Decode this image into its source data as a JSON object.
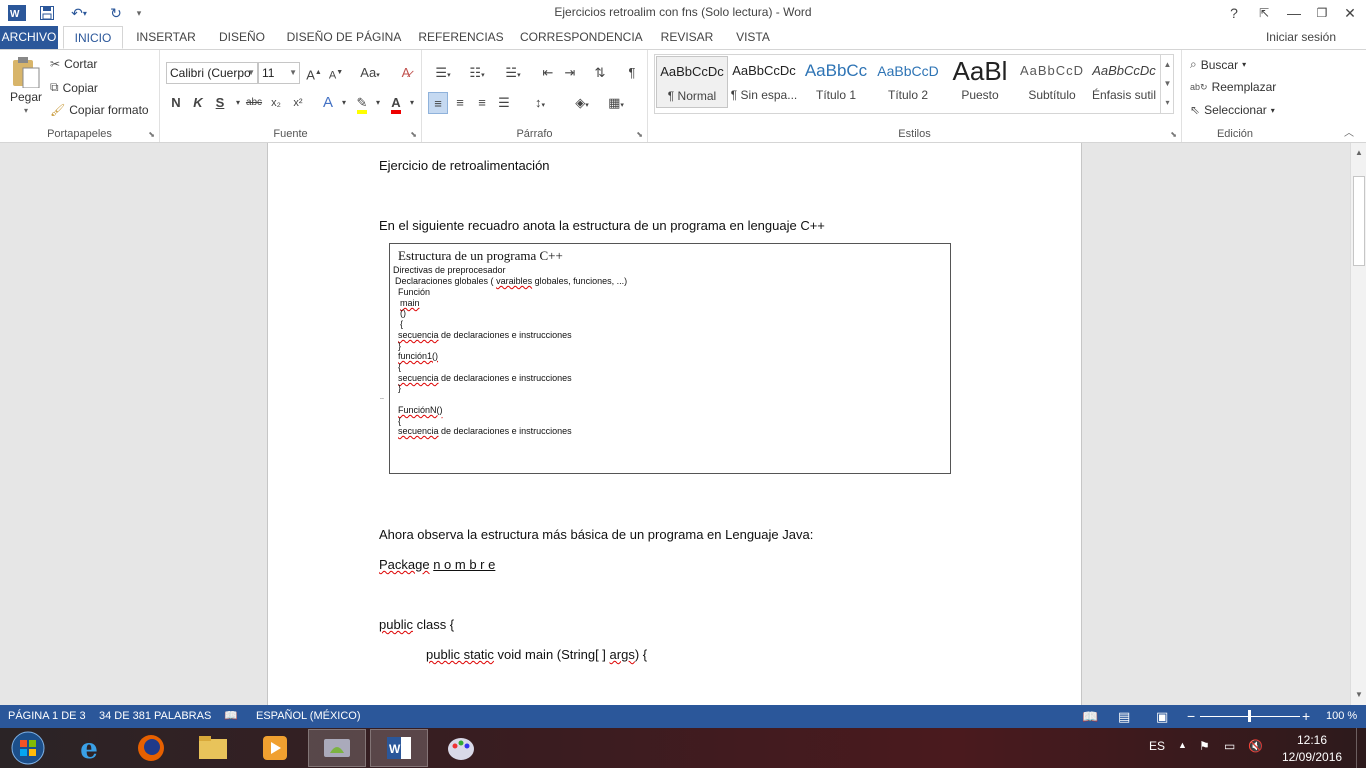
{
  "window": {
    "title": "Ejercicios retroalim con fns (Solo lectura) - Word",
    "help": "?",
    "minimize": "—",
    "restore": "❐",
    "close": "✕"
  },
  "tabs": [
    "ARCHIVO",
    "INICIO",
    "INSERTAR",
    "DISEÑO",
    "DISEÑO DE PÁGINA",
    "REFERENCIAS",
    "CORRESPONDENCIA",
    "REVISAR",
    "VISTA"
  ],
  "signin": "Iniciar sesión",
  "ribbon": {
    "clipboard": {
      "label": "Portapapeles",
      "paste": "Pegar",
      "cut": "Cortar",
      "copy": "Copiar",
      "format_painter": "Copiar formato"
    },
    "font": {
      "label": "Fuente",
      "font_name": "Calibri (Cuerpo",
      "font_size": "11",
      "bold": "N",
      "italic": "K",
      "underline": "S",
      "strike": "abc",
      "sub": "x₂",
      "sup": "x²"
    },
    "paragraph": {
      "label": "Párrafo"
    },
    "styles": {
      "label": "Estilos",
      "items": [
        {
          "preview": "AaBbCcDc",
          "name": "¶ Normal"
        },
        {
          "preview": "AaBbCcDc",
          "name": "¶ Sin espa..."
        },
        {
          "preview": "AaBbCc",
          "name": "Título 1"
        },
        {
          "preview": "AaBbCcD",
          "name": "Título 2"
        },
        {
          "preview": "AaBl",
          "name": "Puesto"
        },
        {
          "preview": "AaBbCcD",
          "name": "Subtítulo"
        },
        {
          "preview": "AaBbCcDc",
          "name": "Énfasis sutil"
        }
      ]
    },
    "editing": {
      "label": "Edición",
      "find": "Buscar",
      "replace": "Reemplazar",
      "select": "Seleccionar"
    }
  },
  "document": {
    "heading": "Ejercicio de retroalimentación",
    "instruction": "En el siguiente recuadro anota la estructura de un programa en lenguaje C++",
    "cpp_box": {
      "title": "Estructura de un programa C++",
      "lines": [
        "Directivas de preprocesador",
        "Declaraciones globales ( varaibles globales, funciones, ...)",
        "Función",
        "main",
        "()",
        "{",
        "secuencia de declaraciones e instrucciones",
        "}",
        "función1()",
        "{",
        "secuencia de declaraciones e instrucciones",
        "}",
        "..",
        "FunciónN()",
        "{",
        "secuencia de declaraciones e instrucciones"
      ]
    },
    "java_intro": "Ahora observa la estructura más básica de un programa en Lenguaje Java:",
    "package_line": "Package   n o m b r e",
    "class_line": "public class {",
    "main_line": "public  static  void  main  (String[ ] args)   {"
  },
  "status": {
    "page": "PÁGINA 1 DE 3",
    "words": "34 DE 381 PALABRAS",
    "language": "ESPAÑOL (MÉXICO)",
    "zoom": "100 %"
  },
  "taskbar": {
    "lang": "ES",
    "time": "12:16",
    "date": "12/09/2016"
  },
  "colors": {
    "accent": "#2b579a",
    "spell_error": "#d00000"
  }
}
